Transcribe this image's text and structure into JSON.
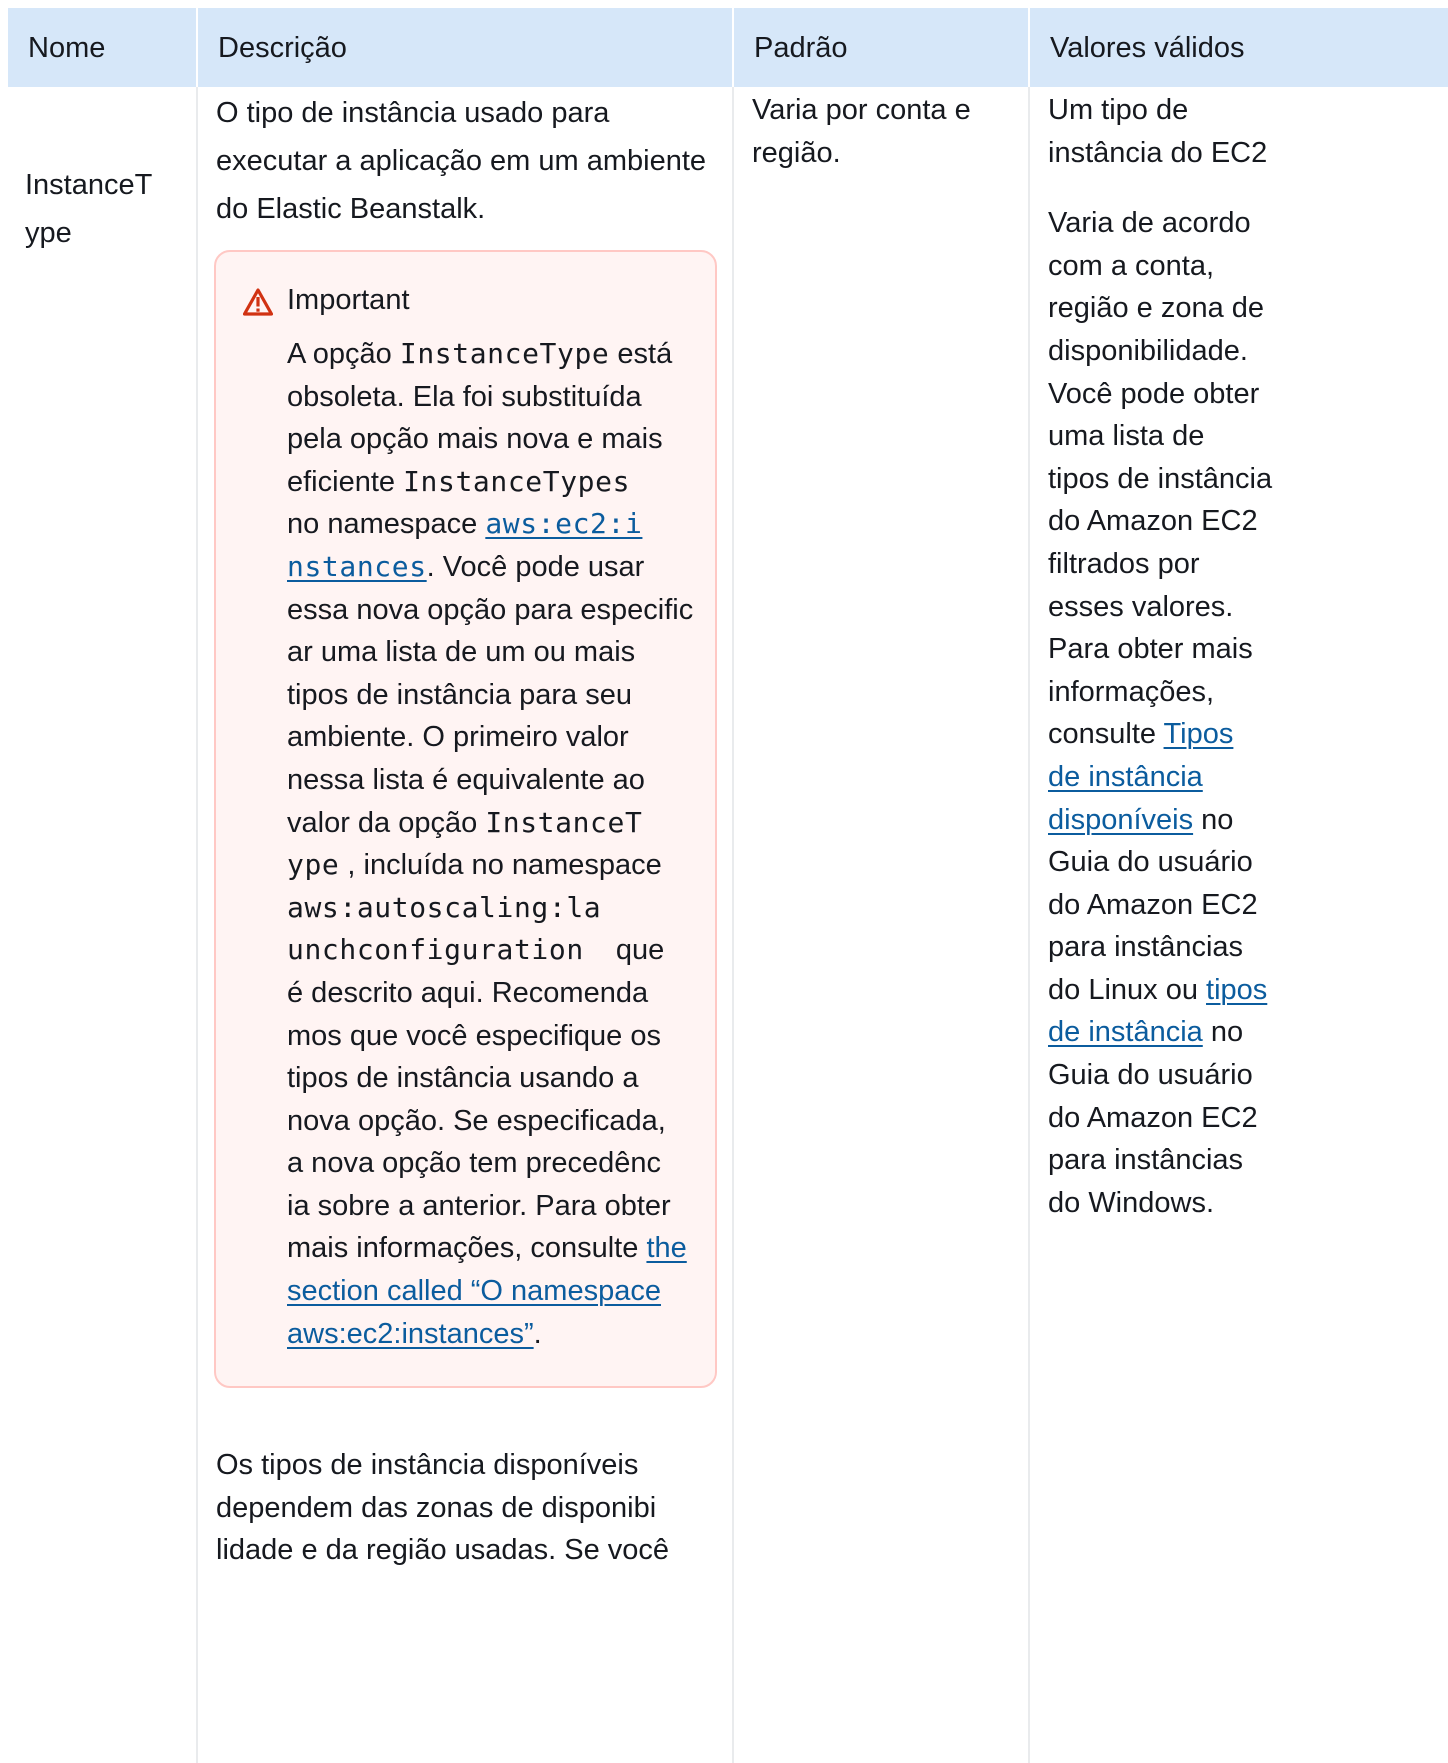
{
  "table": {
    "headers": [
      "Nome",
      "Descrição",
      "Padrão",
      "Valores válidos"
    ],
    "row": {
      "name": [
        "InstanceT",
        "ype"
      ],
      "description": {
        "lines": [
          "O tipo de instância usado para",
          "executar a aplicação em um ambiente",
          "do Elastic Beanstalk."
        ],
        "important": {
          "title": "Important",
          "segments": {
            "s1": "A opção ",
            "c1": "InstanceType",
            "s2": " está",
            "l2": "obsoleta. Ela foi substituída",
            "l3": "pela opção mais nova e mais",
            "s4a": "eficiente ",
            "c4": "InstanceTypes",
            "s5": "no namespace ",
            "link1a": "aws:ec2:i",
            "link1b": "nstances",
            "s6": ". Você pode usar",
            "l7": "essa nova opção para especific",
            "l8": "ar uma lista de um ou mais",
            "l9": "tipos de instância para seu",
            "l10": "ambiente. O primeiro valor",
            "l11": "nessa lista é equivalente ao",
            "s12": "valor da opção ",
            "c12": "InstanceT",
            "c13": "ype",
            "s13": " , incluída no namespace",
            "c14": "aws:autoscaling:la",
            "c15": "unchconfiguration",
            "s15": " que",
            "l16": "é descrito aqui. Recomenda",
            "l17": "mos que você especifique os",
            "l18": "tipos de instância usando a",
            "l19": "nova opção. Se especificada,",
            "l20": "a nova opção tem precedênc",
            "l21": "ia sobre a anterior. Para obter",
            "s22": "mais informações, consulte ",
            "link2a": "the",
            "link2b": "section called “O namespace",
            "link2c": "aws:ec2:instances”",
            "s24": "."
          }
        },
        "after": [
          "Os tipos de instância disponíveis",
          "dependem das zonas de disponibi",
          "lidade e da região usadas. Se você"
        ]
      },
      "default": [
        "Varia por conta e",
        "região."
      ],
      "valid": {
        "p1": [
          "Um tipo de",
          "instância do EC2"
        ],
        "p2": {
          "l1": "Varia de acordo",
          "l2": "com a conta,",
          "l3": "região e zona de",
          "l4": "disponibilidade.",
          "l5": "Você pode obter",
          "l6": "uma lista de",
          "l7": "tipos de instância",
          "l8": "do Amazon EC2",
          "l9": "filtrados por",
          "l10": "esses valores.",
          "l11": "Para obter mais",
          "l12": "informações,",
          "l13a": "consulte ",
          "link1a": "Tipos",
          "link1b": "de instância",
          "link1c": "disponíveis",
          "l15b": " no",
          "l16": "Guia do usuário",
          "l17": "do Amazon EC2",
          "l18": "para instâncias",
          "l19a": "do Linux ou ",
          "link2a": "tipos",
          "link2b": "de instância",
          "l20b": " no",
          "l21": "Guia do usuário",
          "l22": "do Amazon EC2",
          "l23": "para instâncias",
          "l24": "do Windows."
        }
      }
    }
  },
  "colors": {
    "header_bg": "#d6e7f9",
    "warning_bg": "#fff4f3",
    "warning_border": "#ffc8c4",
    "warning_icon": "#d13212",
    "link": "#0b5c9e"
  },
  "icons": {
    "warning": "warning-triangle-icon"
  }
}
